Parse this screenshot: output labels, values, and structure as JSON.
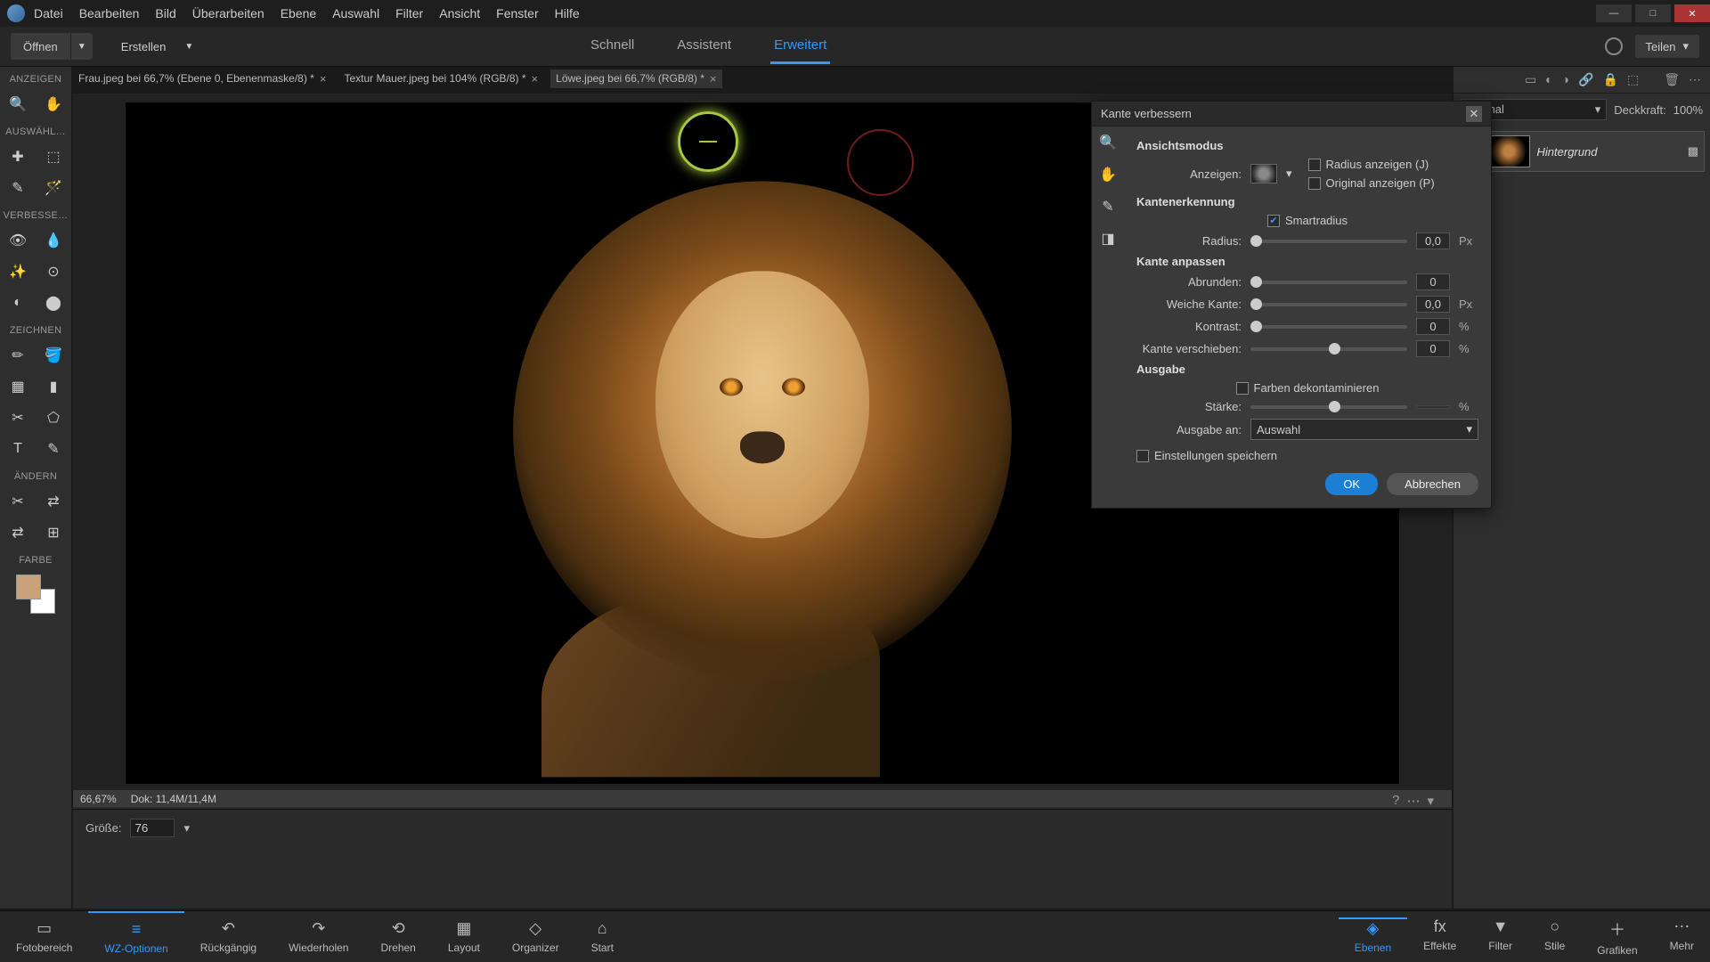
{
  "menus": [
    "Datei",
    "Bearbeiten",
    "Bild",
    "Überarbeiten",
    "Ebene",
    "Auswahl",
    "Filter",
    "Ansicht",
    "Fenster",
    "Hilfe"
  ],
  "open_btn": "Öffnen",
  "create_btn": "Erstellen",
  "mode_tabs": [
    "Schnell",
    "Assistent",
    "Erweitert"
  ],
  "mode_active": 2,
  "share": "Teilen",
  "doc_tabs": [
    {
      "label": "Frau.jpeg bei 66,7% (Ebene 0, Ebenenmaske/8) *"
    },
    {
      "label": "Textur Mauer.jpeg bei 104% (RGB/8) *"
    },
    {
      "label": "Löwe.jpeg bei 66,7% (RGB/8) *"
    }
  ],
  "active_doc": 2,
  "sidebar": {
    "cats": [
      "ANZEIGEN",
      "AUSWÄHL…",
      "VERBESSE…",
      "ZEICHNEN",
      "ÄNDERN",
      "FARBE"
    ],
    "tools": [
      [
        "🔍",
        "✋"
      ],
      [
        "✚",
        "⬚",
        "✎",
        "🪄"
      ],
      [
        "👁",
        "💧",
        "✨",
        "⊙",
        "◐",
        "⬤"
      ],
      [
        "✏",
        "🪣",
        "▦",
        "▮",
        "✂",
        "⬠",
        "T",
        "✎"
      ],
      [
        "✂",
        "⇄",
        "⇄",
        "⊞"
      ]
    ]
  },
  "status": {
    "zoom": "66,67%",
    "doc": "Dok: 11,4M/11,4M"
  },
  "opts": {
    "size_label": "Größe:",
    "size_val": "76"
  },
  "layer_panel": {
    "blend": "Normal",
    "opacity_label": "Deckkraft:",
    "opacity": "100%",
    "layer": "Hintergrund"
  },
  "dialog": {
    "title": "Kante verbessern",
    "sec1": "Ansichtsmodus",
    "show_label": "Anzeigen:",
    "show_radius": "Radius anzeigen (J)",
    "show_orig": "Original anzeigen (P)",
    "sec2": "Kantenerkennung",
    "smart": "Smartradius",
    "radius_label": "Radius:",
    "radius_val": "0,0",
    "radius_unit": "Px",
    "sec3": "Kante anpassen",
    "smooth_label": "Abrunden:",
    "smooth_val": "0",
    "feather_label": "Weiche Kante:",
    "feather_val": "0,0",
    "feather_unit": "Px",
    "contrast_label": "Kontrast:",
    "contrast_val": "0",
    "contrast_unit": "%",
    "shift_label": "Kante verschieben:",
    "shift_val": "0",
    "shift_unit": "%",
    "sec4": "Ausgabe",
    "decon": "Farben dekontaminieren",
    "amount_label": "Stärke:",
    "amount_unit": "%",
    "output_label": "Ausgabe an:",
    "output_val": "Auswahl",
    "remember": "Einstellungen speichern",
    "ok": "OK",
    "cancel": "Abbrechen"
  },
  "bottombar": {
    "left": [
      "Fotobereich",
      "WZ-Optionen",
      "Rückgängig",
      "Wiederholen",
      "Drehen",
      "Layout",
      "Organizer",
      "Start"
    ],
    "left_icons": [
      "▭",
      "≡",
      "↶",
      "↷",
      "⟲",
      "▦",
      "◇",
      "⌂"
    ],
    "left_active": 1,
    "right": [
      "Ebenen",
      "Effekte",
      "Filter",
      "Stile",
      "Grafiken",
      "Mehr"
    ],
    "right_icons": [
      "◈",
      "fx",
      "▼",
      "○",
      "＋",
      "⋯"
    ],
    "right_active": 0
  }
}
